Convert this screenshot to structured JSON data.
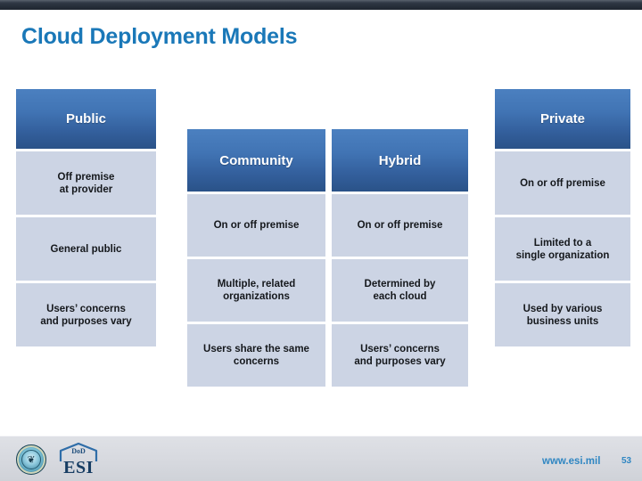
{
  "slide": {
    "title": "Cloud Deployment Models",
    "title_color": "#1a78b8",
    "header_color_start": "#4b80c0",
    "header_color_end": "#2a5288",
    "cell_color": "#ccd4e4"
  },
  "columns": [
    {
      "key": "public",
      "header": "Public",
      "cells": [
        "Off premise\nat provider",
        "General public",
        "Users’ concerns\nand purposes vary"
      ],
      "cell_lines": [
        [
          "Off premise",
          "at provider"
        ],
        [
          "General public"
        ],
        [
          "Users’ concerns",
          "and purposes vary"
        ]
      ]
    },
    {
      "key": "community",
      "header": "Community",
      "cells": [
        "On or off premise",
        "Multiple, related\norganizations",
        "Users share the same\nconcerns"
      ],
      "cell_lines": [
        [
          "On or off premise"
        ],
        [
          "Multiple, related",
          "organizations"
        ],
        [
          "Users share the same",
          "concerns"
        ]
      ]
    },
    {
      "key": "hybrid",
      "header": "Hybrid",
      "cells": [
        "On or off premise",
        "Determined by\neach cloud",
        "Users’ concerns\nand purposes vary"
      ],
      "cell_lines": [
        [
          "On or off premise"
        ],
        [
          "Determined by",
          "each cloud"
        ],
        [
          "Users’ concerns",
          "and purposes vary"
        ]
      ]
    },
    {
      "key": "private",
      "header": "Private",
      "cells": [
        "On or off premise",
        "Limited to a\nsingle organization",
        "Used by various\nbusiness units"
      ],
      "cell_lines": [
        [
          "On or off premise"
        ],
        [
          "Limited to a",
          "single organization"
        ],
        [
          "Used by various",
          "business units"
        ]
      ]
    }
  ],
  "footer": {
    "url": "www.esi.mil",
    "page_number": "53",
    "url_color": "#2f86c2",
    "esi_logo_top": "DoD",
    "esi_logo_main": "ESI",
    "seal_glyph": "❦"
  }
}
